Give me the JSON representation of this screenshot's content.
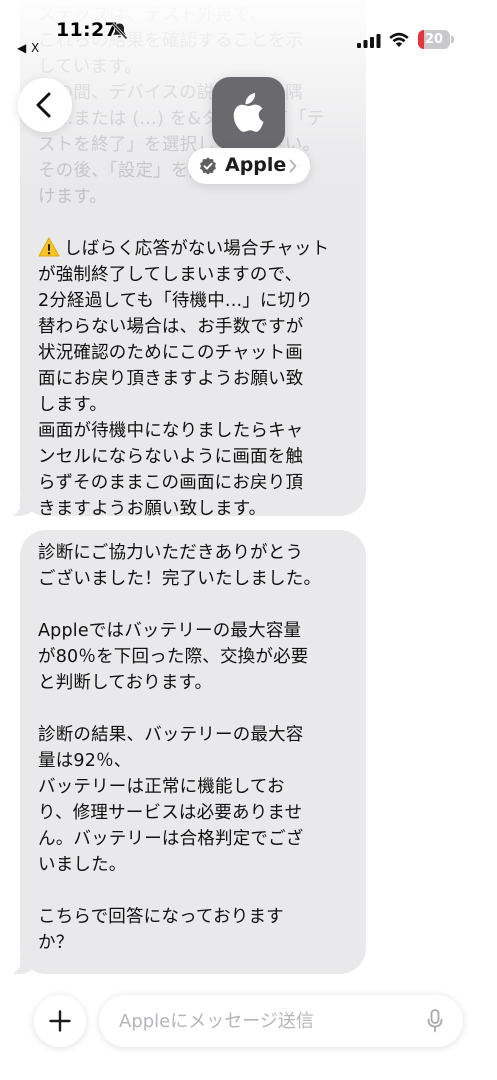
{
  "status_bar": {
    "time": "11:27",
    "back_app": "◀ X",
    "battery_level": "20",
    "battery_fraction": 0.2,
    "battery_color": "#e5343f"
  },
  "header": {
    "contact_name": "Apple",
    "avatar_icon": "apple-logo-icon",
    "verified_icon": "verified-badge-icon"
  },
  "messages": [
    {
      "faded_lines": "ステップは、テスト外見で、\nこれらの結果を確認することを示\nしています。\nその間、デバイスの説明の右上隅\nの…または (…) を&タップして「テ\nストを終了」を選択してください。\nその後、「設定」を開いて…だ\nけます。",
      "warning_icon": "warning-icon",
      "warning_paragraph": "しばらく応答がない場合チャット\nが強制終了してしまいますので、\n2分経過しても「待機中...」に切り\n替わらない場合は、お手数ですが\n状況確認のためにこのチャット画\n面にお戻り頂きますようお願い致\nします。\n画面が待機中になりましたらキャ\nンセルにならないように画面を触\nらずそのままこの画面にお戻り頂\nきますようお願い致します。"
    },
    {
      "paragraphs": [
        "診断にご協力いただきありがとう\nございました！完了いたしました。",
        "Appleではバッテリーの最大容量\nが80％を下回った際、交換が必要\nと判断しております。",
        "診断の結果、バッテリーの最大容\n量は92％、\nバッテリーは正常に機能してお\nり、修理サービスは必要ありませ\nん。バッテリーは合格判定でござ\nいました。",
        "こちらで回答になっております\nか？"
      ]
    }
  ],
  "composer": {
    "placeholder": "Appleにメッセージ送信",
    "plus_icon": "plus-icon",
    "mic_icon": "microphone-icon"
  }
}
